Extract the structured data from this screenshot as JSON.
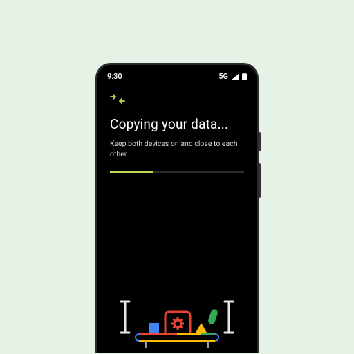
{
  "status": {
    "time": "9:30",
    "network": "5G"
  },
  "screen": {
    "title": "Copying your data...",
    "subtitle": "Keep both devices on and close to each other",
    "progress_percent": 32
  },
  "colors": {
    "accent": "#c5d651",
    "bg": "#000000",
    "frame_bg": "#e5f2e5",
    "ill_red": "#ea4335",
    "ill_blue": "#4285f4",
    "ill_green": "#34a853",
    "ill_yellow": "#fbbc04"
  },
  "icons": {
    "transfer": "transfer-arrows-icon",
    "signal": "signal-icon",
    "battery": "battery-icon"
  }
}
